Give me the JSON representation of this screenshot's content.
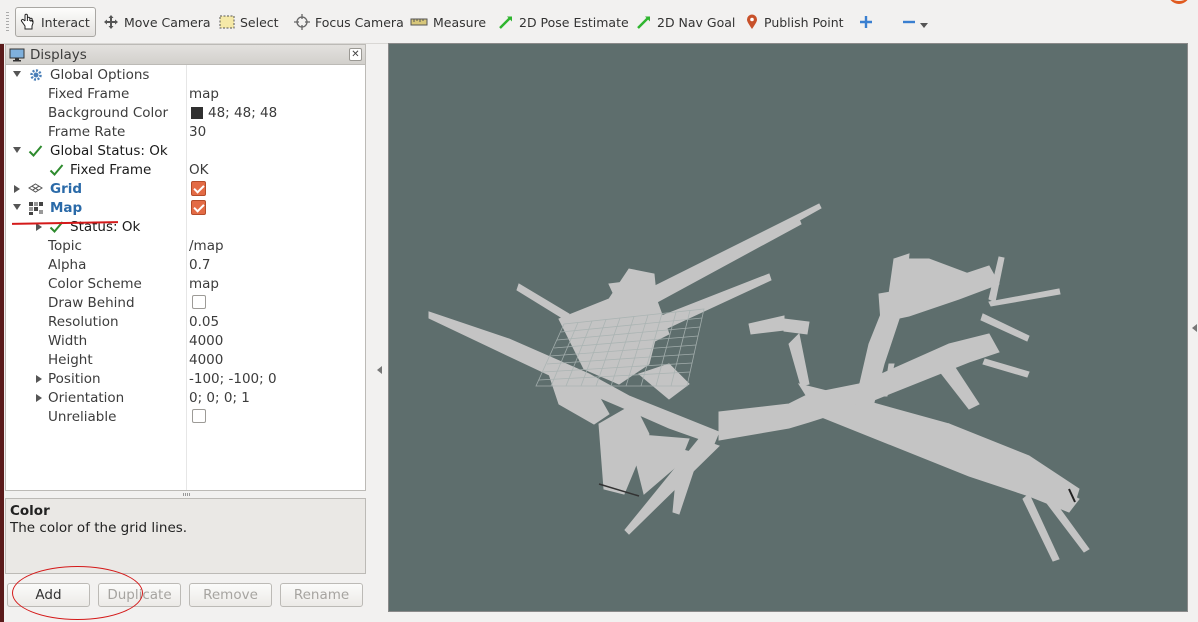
{
  "toolbar": {
    "items": [
      {
        "label": "Interact",
        "icon": "hand-cursor-icon",
        "active": true
      },
      {
        "label": "Move Camera",
        "icon": "move-camera-icon"
      },
      {
        "label": "Select",
        "icon": "select-box-icon"
      },
      {
        "label": "Focus Camera",
        "icon": "focus-camera-icon"
      },
      {
        "label": "Measure",
        "icon": "ruler-icon"
      },
      {
        "label": "2D Pose Estimate",
        "icon": "green-arrow-icon"
      },
      {
        "label": "2D Nav Goal",
        "icon": "green-arrow-icon"
      },
      {
        "label": "Publish Point",
        "icon": "map-pin-icon"
      }
    ]
  },
  "displays": {
    "title": "Displays",
    "rows": [
      {
        "label": "Global Options",
        "value": ""
      },
      {
        "label": "Fixed Frame",
        "value": "map"
      },
      {
        "label": "Background Color",
        "value": "48; 48; 48"
      },
      {
        "label": "Frame Rate",
        "value": "30"
      },
      {
        "label": "Global Status: Ok",
        "value": ""
      },
      {
        "label": "Fixed Frame",
        "value": "OK"
      },
      {
        "label": "Grid",
        "value": ""
      },
      {
        "label": "Map",
        "value": ""
      },
      {
        "label": "Status: Ok",
        "value": ""
      },
      {
        "label": "Topic",
        "value": "/map"
      },
      {
        "label": "Alpha",
        "value": "0.7"
      },
      {
        "label": "Color Scheme",
        "value": "map"
      },
      {
        "label": "Draw Behind",
        "value": ""
      },
      {
        "label": "Resolution",
        "value": "0.05"
      },
      {
        "label": "Width",
        "value": "4000"
      },
      {
        "label": "Height",
        "value": "4000"
      },
      {
        "label": "Position",
        "value": "-100; -100; 0"
      },
      {
        "label": "Orientation",
        "value": "0; 0; 0; 1"
      },
      {
        "label": "Unreliable",
        "value": ""
      }
    ],
    "checkboxes": {
      "grid_enabled": true,
      "map_enabled": true,
      "draw_behind": false,
      "unreliable": false
    }
  },
  "help": {
    "title": "Color",
    "description": "The color of the grid lines."
  },
  "buttons": {
    "add": "Add",
    "duplicate": "Duplicate",
    "remove": "Remove",
    "rename": "Rename"
  },
  "colors": {
    "view_background": "#5e6e6d",
    "map_free_space": "#c4c4c4",
    "checkbox_on": "#e36b45",
    "status_ok": "#2e8b2e",
    "annotation_red": "#d41a1a"
  }
}
